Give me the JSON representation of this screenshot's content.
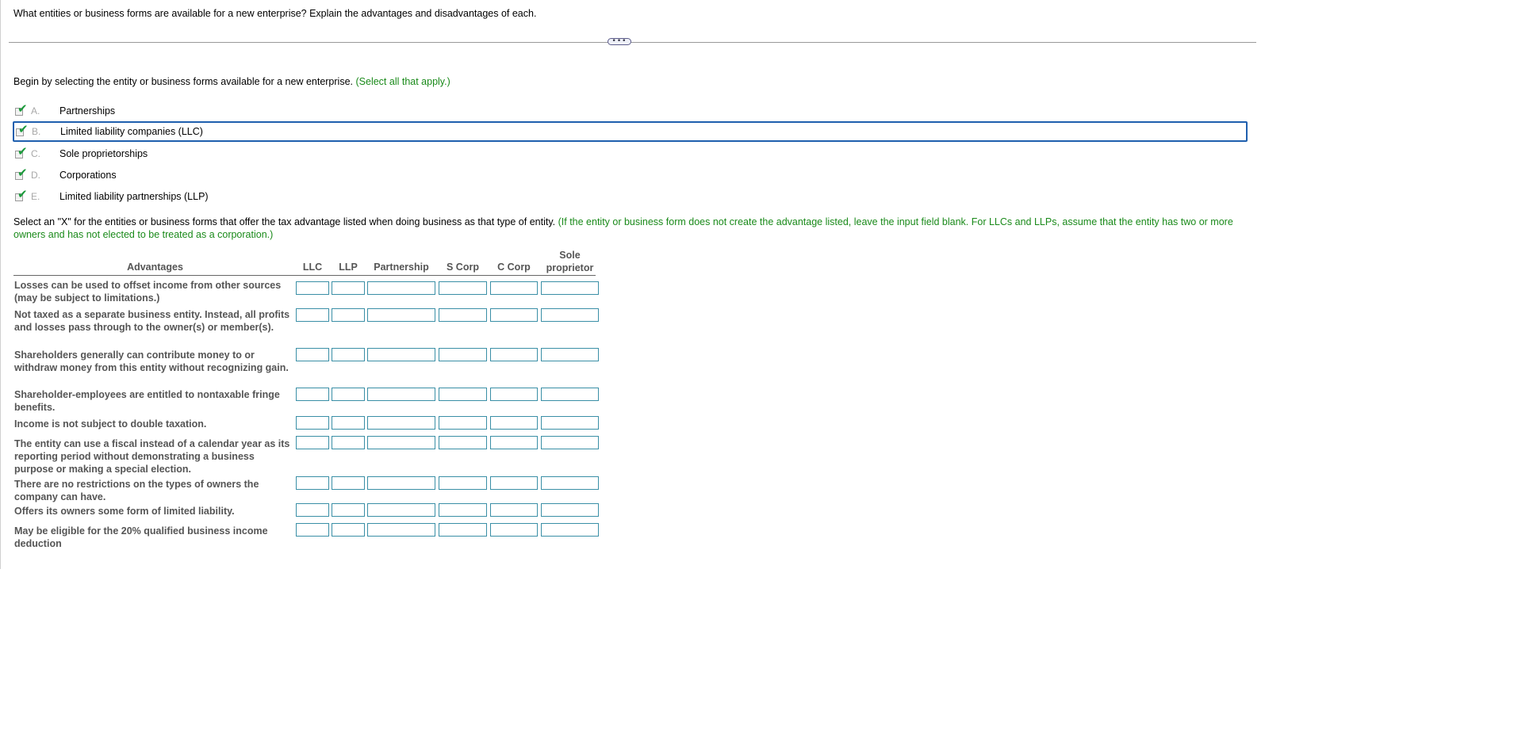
{
  "question": "What entities or business forms are available for a new enterprise? Explain the advantages and disadvantages of each.",
  "divider_handle": "•••",
  "instruction1": {
    "text": "Begin by selecting the entity or business forms available for a new enterprise.",
    "hint": "(Select all that apply.)"
  },
  "choices": [
    {
      "letter": "A.",
      "label": "Partnerships",
      "checked": true
    },
    {
      "letter": "B.",
      "label": "Limited liability companies (LLC)",
      "checked": true,
      "focused": true
    },
    {
      "letter": "C.",
      "label": "Sole proprietorships",
      "checked": true
    },
    {
      "letter": "D.",
      "label": "Corporations",
      "checked": true
    },
    {
      "letter": "E.",
      "label": "Limited liability partnerships (LLP)",
      "checked": true
    }
  ],
  "check_icon": "checkmark-icon",
  "instruction2": {
    "text": "Select an \"X\" for the entities or business forms that offer the tax advantage listed when doing business as that type of entity.",
    "hint": "(If the entity or business form does not create the advantage listed, leave the input field blank. For LLCs and LLPs, assume that the entity has two or more owners and has not elected to be treated as a corporation.)"
  },
  "table": {
    "header_advantages": "Advantages",
    "columns": [
      "LLC",
      "LLP",
      "Partnership",
      "S Corp",
      "C Corp",
      "Sole proprietor"
    ],
    "rows": [
      "Losses can be used to offset income from other sources (may be subject to limitations.)",
      "Not taxed as a separate business entity. Instead, all profits and losses pass through to the owner(s) or member(s).",
      "Shareholders generally can contribute money to or withdraw money from this entity without recognizing gain.",
      "Shareholder-employees are entitled to nontaxable fringe benefits.",
      "Income is not subject to double taxation.",
      "The entity can use a fiscal instead of a calendar year as its reporting period without demonstrating a business purpose or making a special election.",
      "There are no restrictions on the types of owners the company can have.",
      "Offers its owners some form of limited liability.",
      "May be eligible for the 20% qualified business income deduction"
    ]
  },
  "colors": {
    "hint": "#1a8a1a",
    "input_border": "#3a8fa6",
    "focus_border": "#1f5fae",
    "check": "#1a9a3a"
  }
}
